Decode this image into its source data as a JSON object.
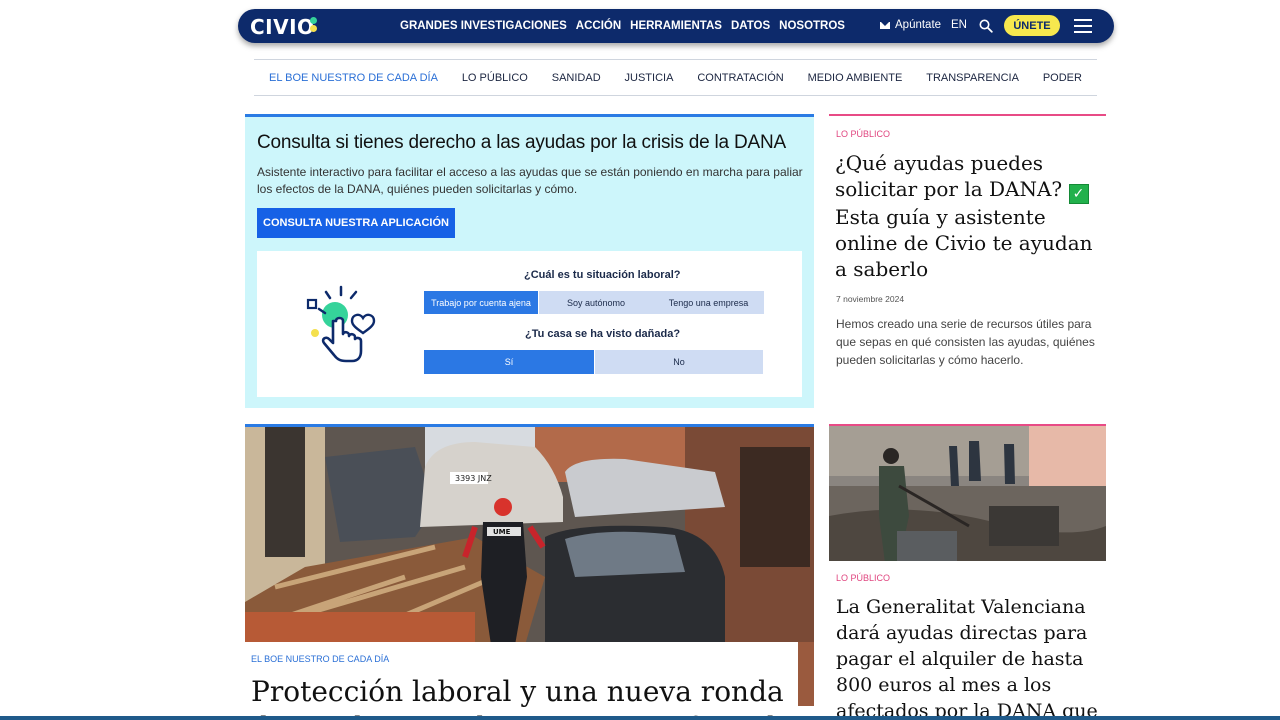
{
  "header": {
    "logo": "CIVIO",
    "nav": [
      "GRANDES INVESTIGACIONES",
      "ACCIÓN",
      "HERRAMIENTAS",
      "DATOS",
      "NOSOTROS"
    ],
    "subscribe_label": "Apúntate",
    "language": "EN",
    "join_label": "ÚNETE"
  },
  "categories": [
    "EL BOE NUESTRO DE CADA DÍA",
    "LO PÚBLICO",
    "SANIDAD",
    "JUSTICIA",
    "CONTRATACIÓN",
    "MEDIO AMBIENTE",
    "TRANSPARENCIA",
    "PODER"
  ],
  "dana_card": {
    "title": "Consulta si tienes derecho a las ayudas por la crisis de la DANA",
    "description": "Asistente interactivo para facilitar el acceso a las ayudas que se están poniendo en marcha para paliar los efectos de la DANA, quiénes pueden solicitarlas y cómo.",
    "button": "CONSULTA NUESTRA APLICACIÓN",
    "question1": "¿Cuál es tu situación laboral?",
    "options1": [
      "Trabajo por cuenta ajena",
      "Soy autónomo",
      "Tengo una empresa"
    ],
    "question2": "¿Tu casa se ha visto dañada?",
    "options2": [
      "Sí",
      "No"
    ]
  },
  "article1": {
    "tag": "LO PÚBLICO",
    "title": "¿Qué ayudas puedes solicitar por la DANA?",
    "title_after": "Esta guía y asistente online de Civio te ayudan a saberlo",
    "date": "7 noviembre 2024",
    "excerpt": "Hemos creado una serie de recursos útiles para que sepas en qué consisten las ayudas, quiénes pueden solicitarlas y cómo hacerlo."
  },
  "main_article": {
    "tag": "EL BOE NUESTRO DE CADA DÍA",
    "title": "Protección laboral y una nueva ronda de ayudas para las empresas afectadas por la DANA",
    "photo_text": {
      "plate": "3393 JNZ",
      "vest": "UME"
    }
  },
  "article2": {
    "tag": "LO PÚBLICO",
    "title": "La Generalitat Valenciana dará ayudas directas para pagar el alquiler de hasta 800 euros al mes a los afectados por la DANA que"
  },
  "colors": {
    "nav_bg": "#0d2a6b",
    "accent_blue": "#1661e6",
    "accent_pink": "#e84b86",
    "join_yellow": "#f7e84e",
    "dana_bg": "#cdf6fb"
  }
}
